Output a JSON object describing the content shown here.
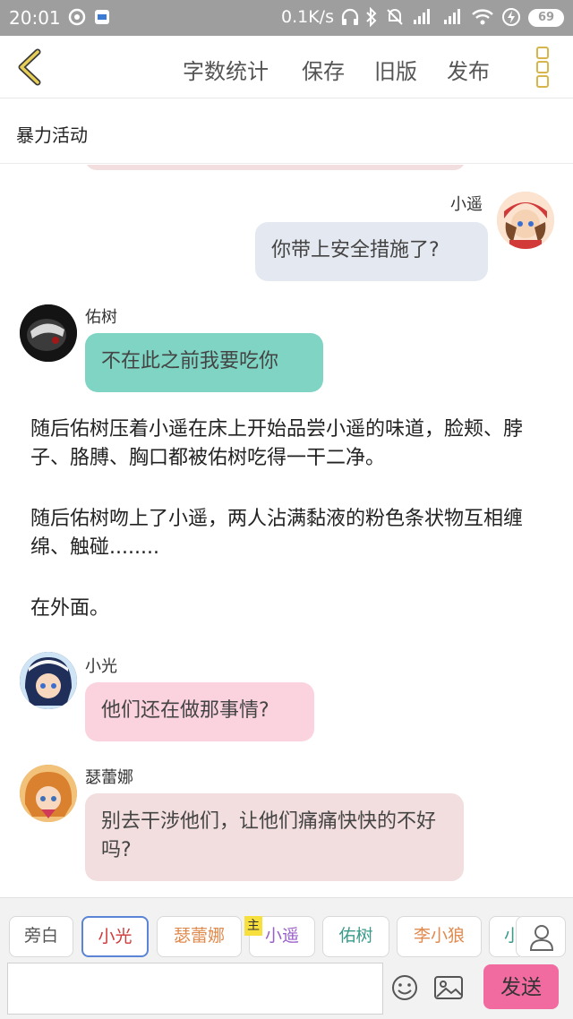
{
  "status_bar": {
    "time": "20:01",
    "net_speed": "0.1K/s",
    "battery": "69"
  },
  "header": {
    "actions": [
      "字数统计",
      "保存",
      "旧版",
      "发布"
    ]
  },
  "story_title": "暴力活动",
  "messages": [
    {
      "speaker": "小遥",
      "text": "你带上安全措施了?"
    },
    {
      "speaker": "佑树",
      "text": "不在此之前我要吃你"
    }
  ],
  "narration": [
    "随后佑树压着小遥在床上开始品尝小遥的味道，脸颊、脖子、胳膊、胸口都被佑树吃得一干二净。",
    "随后佑树吻上了小遥，两人沾满黏液的粉色条状物互相缠绵、触碰........",
    "在外面。"
  ],
  "messages2": [
    {
      "speaker": "小光",
      "text": "他们还在做那事情?"
    },
    {
      "speaker": "瑟蕾娜",
      "text": "别去干涉他们，让他们痛痛快快的不好吗?"
    }
  ],
  "roles": [
    {
      "label": "旁白",
      "color": "#555555"
    },
    {
      "label": "小光",
      "color": "#d13a3a"
    },
    {
      "label": "瑟蕾娜",
      "color": "#e08a4e"
    },
    {
      "label": "小遥",
      "color": "#9a5fc8"
    },
    {
      "label": "佑树",
      "color": "#3a9a8a"
    },
    {
      "label": "李小狼",
      "color": "#e08a4e"
    },
    {
      "label": "小",
      "color": "#3a9a8a"
    }
  ],
  "host_tag": "主",
  "input": {
    "value": ""
  },
  "send_label": "发送",
  "colors": {
    "bubble_right": "#e4e8f0",
    "bubble_teal": "#7fd4c3",
    "bubble_pink": "#fbd3df",
    "bubble_rose": "#f2dede",
    "send": "#f16aa0"
  }
}
